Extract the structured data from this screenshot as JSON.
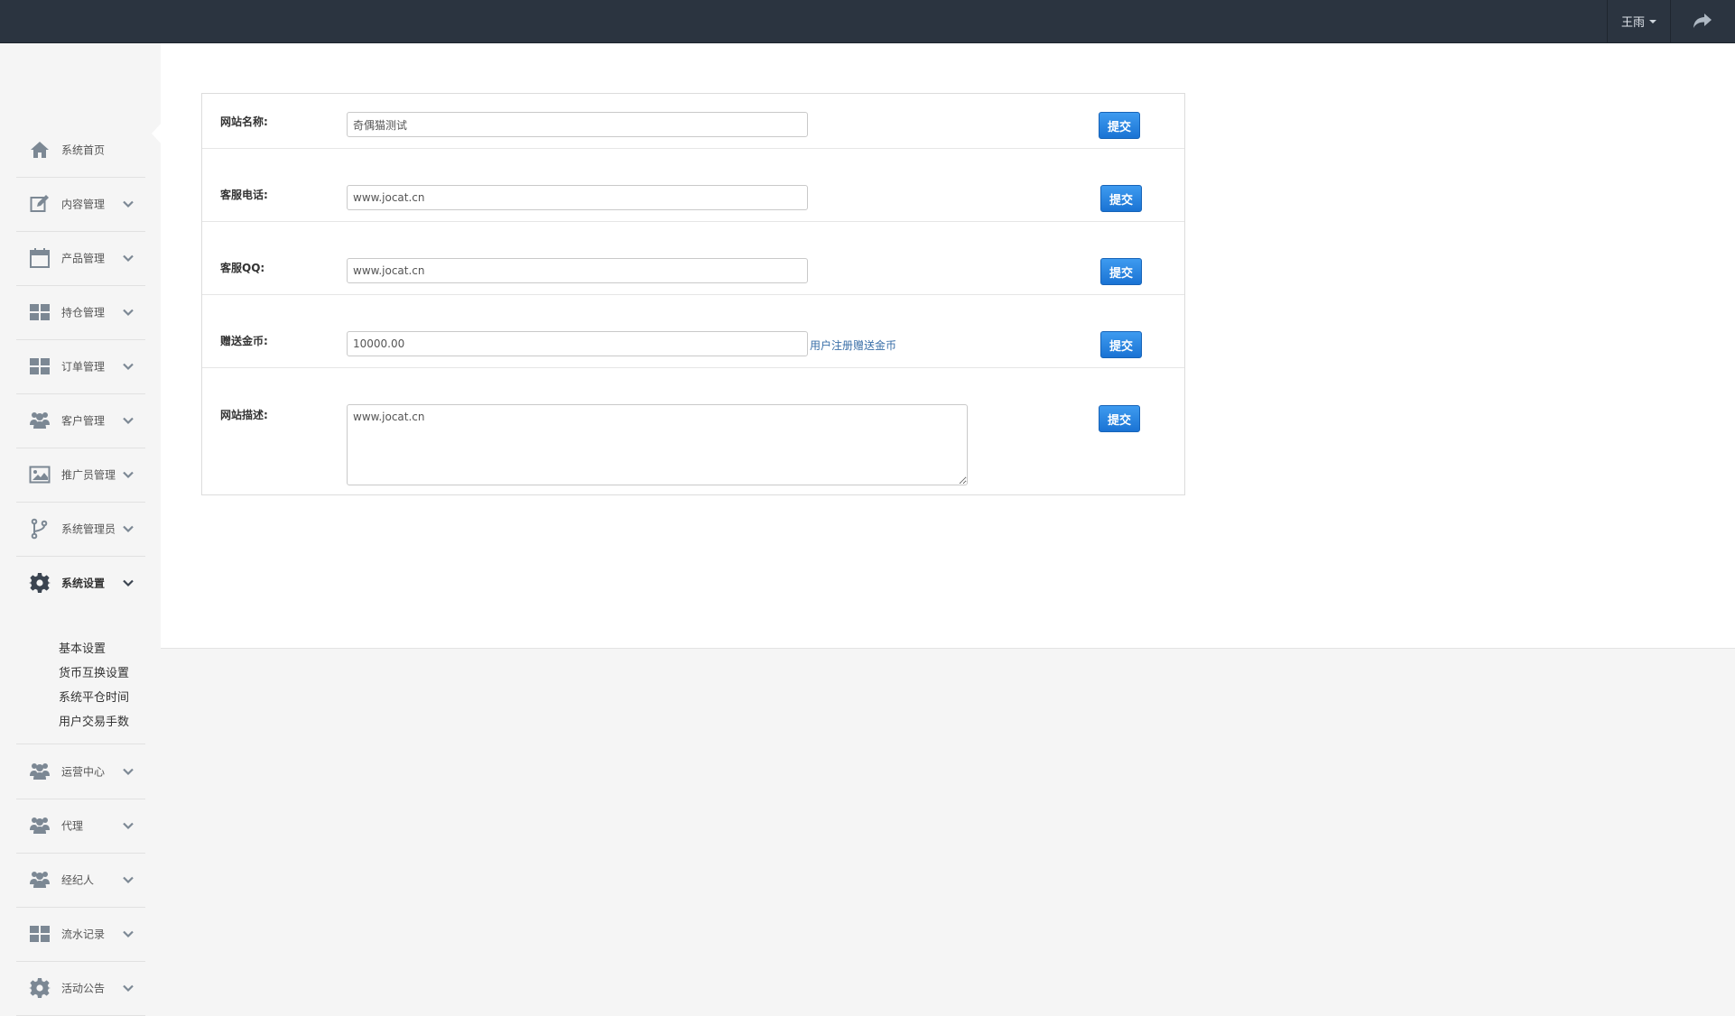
{
  "header": {
    "user_name": "王雨",
    "icons": {
      "dropdown": "caret-down-icon",
      "share": "share-icon"
    }
  },
  "sidebar": {
    "items": [
      {
        "label": "系统首页",
        "icon": "home-icon"
      },
      {
        "label": "内容管理",
        "icon": "edit-icon"
      },
      {
        "label": "产品管理",
        "icon": "calendar-icon"
      },
      {
        "label": "持仓管理",
        "icon": "grid-icon"
      },
      {
        "label": "订单管理",
        "icon": "grid-icon"
      },
      {
        "label": "客户管理",
        "icon": "users-icon"
      },
      {
        "label": "推广员管理",
        "icon": "image-icon"
      },
      {
        "label": "系统管理员",
        "icon": "branch-icon"
      },
      {
        "label": "系统设置",
        "icon": "gear-icon",
        "active": true
      },
      {
        "label": "运营中心",
        "icon": "users-icon"
      },
      {
        "label": "代理",
        "icon": "users-icon"
      },
      {
        "label": "经纪人",
        "icon": "users-icon"
      },
      {
        "label": "流水记录",
        "icon": "grid-icon"
      },
      {
        "label": "活动公告",
        "icon": "gear-icon"
      }
    ],
    "settings_sub": [
      "基本设置",
      "货币互换设置",
      "系统平仓时间",
      "用户交易手数"
    ]
  },
  "form": {
    "submit_label": "提交",
    "site_name": {
      "label": "网站名称:",
      "value": "奇偶猫测试"
    },
    "service_phone": {
      "label": "客服电话:",
      "value": "www.jocat.cn"
    },
    "service_qq": {
      "label": "客服QQ:",
      "value": "www.jocat.cn"
    },
    "gift_coins": {
      "label": "赠送金币:",
      "value": "10000.00",
      "hint": "用户注册赠送金币"
    },
    "site_desc": {
      "label": "网站描述:",
      "value": "www.jocat.cn"
    }
  },
  "colors": {
    "topbar": "#2b3440",
    "button": "#1a73d4",
    "hint": "#3a6fa8",
    "icon": "#7c8894"
  }
}
